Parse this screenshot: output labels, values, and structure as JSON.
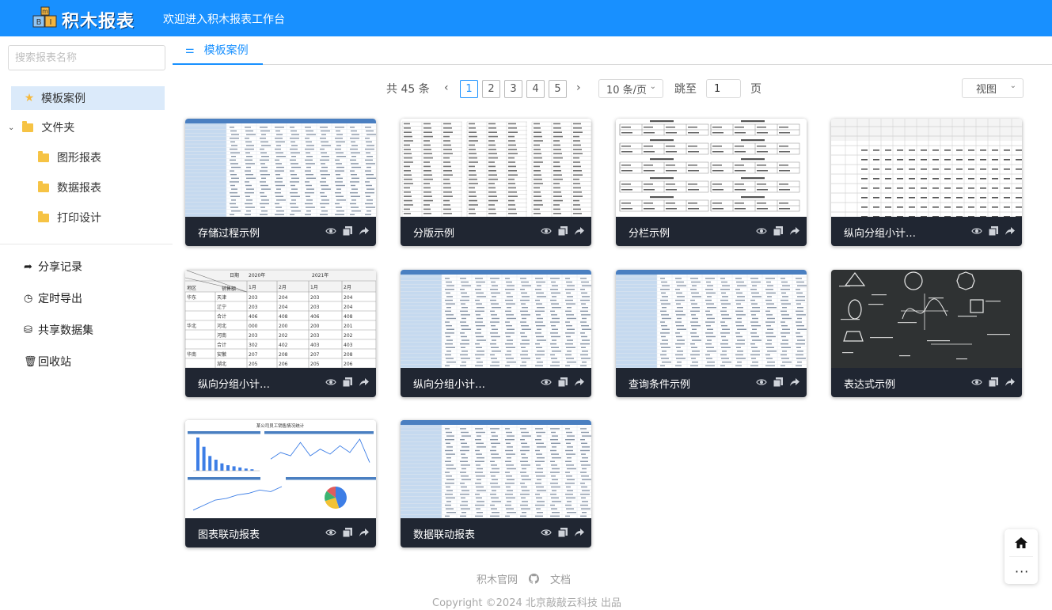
{
  "header": {
    "app_name": "积木报表",
    "welcome": "欢迎进入积木报表工作台",
    "colors": {
      "primary": "#1890ff",
      "card_footer": "#202632"
    }
  },
  "sidebar": {
    "search_placeholder": "搜索报表名称",
    "tree": [
      {
        "label": "模板案例",
        "icon": "star-icon",
        "active": true
      },
      {
        "label": "文件夹",
        "icon": "folder-icon"
      },
      {
        "label": "图形报表",
        "icon": "folder-icon"
      },
      {
        "label": "数据报表",
        "icon": "folder-icon"
      },
      {
        "label": "打印设计",
        "icon": "folder-icon"
      }
    ],
    "nav": [
      {
        "label": "分享记录",
        "icon": "share-icon"
      },
      {
        "label": "定时导出",
        "icon": "clock-icon"
      },
      {
        "label": "共享数据集",
        "icon": "database-icon"
      },
      {
        "label": "回收站",
        "icon": "trash-icon"
      }
    ]
  },
  "tabs": [
    {
      "label": "模板案例",
      "icon": "sliders-icon"
    }
  ],
  "pagination": {
    "total_label": "共 45 条",
    "pages": [
      "1",
      "2",
      "3",
      "4",
      "5"
    ],
    "current": "1",
    "page_size": "10 条/页",
    "jump_label": "跳至",
    "jump_value": "1",
    "page_unit": "页",
    "view_select": "视图"
  },
  "cards": [
    {
      "title": "存储过程示例",
      "thumb": "table-blue"
    },
    {
      "title": "分版示例",
      "thumb": "split"
    },
    {
      "title": "分栏示例",
      "thumb": "columns"
    },
    {
      "title": "纵向分组小计…",
      "thumb": "group-wide"
    },
    {
      "title": "纵向分组小计…",
      "thumb": "group-header"
    },
    {
      "title": "纵向分组小计…",
      "thumb": "table-blue"
    },
    {
      "title": "查询条件示例",
      "thumb": "table-blue"
    },
    {
      "title": "表达式示例",
      "thumb": "chalkboard"
    },
    {
      "title": "图表联动报表",
      "thumb": "charts"
    },
    {
      "title": "数据联动报表",
      "thumb": "table-blue"
    }
  ],
  "footer": {
    "links": [
      "积木官网",
      "文档"
    ],
    "copyright": "Copyright ©2024 北京敲敲云科技 出品"
  },
  "group_header_thumb": {
    "h1": "日期",
    "y1": "2020年",
    "y2": "2021年",
    "region": "地区",
    "sales": "销售额",
    "months": [
      "1月",
      "2月",
      "1月",
      "2月"
    ],
    "rows": [
      [
        "华东",
        "天津",
        "203",
        "204",
        "203",
        "204"
      ],
      [
        "",
        "辽宁",
        "203",
        "204",
        "203",
        "204"
      ],
      [
        "",
        "合计",
        "406",
        "408",
        "406",
        "408"
      ],
      [
        "华北",
        "河北",
        "000",
        "200",
        "200",
        "201"
      ],
      [
        "",
        "河南",
        "203",
        "202",
        "203",
        "202"
      ],
      [
        "",
        "合计",
        "302",
        "402",
        "403",
        "403"
      ],
      [
        "华南",
        "安徽",
        "207",
        "208",
        "207",
        "208"
      ],
      [
        "",
        "湖北",
        "205",
        "206",
        "205",
        "206"
      ],
      [
        "",
        "合计",
        "412",
        "414",
        "412",
        "414"
      ]
    ]
  },
  "charts_thumb": {
    "title": "某公司员工销售情况统计",
    "bars": [
      9,
      6.5,
      4,
      3,
      2,
      1.5,
      1.2,
      0.9,
      0.6,
      0.4
    ],
    "line1": [
      3,
      5,
      4,
      8,
      4,
      6,
      4.5,
      7,
      5,
      9,
      2
    ],
    "line2": [
      1,
      2.5,
      4,
      4.5,
      5.5,
      6,
      7,
      6.5,
      8
    ],
    "pie": [
      45,
      25,
      15,
      15
    ]
  }
}
